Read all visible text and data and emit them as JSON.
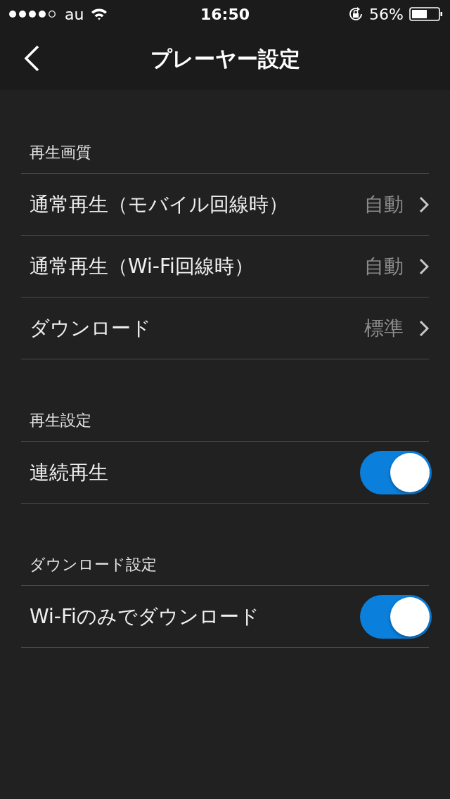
{
  "status_bar": {
    "carrier": "au",
    "time": "16:50",
    "battery_percent": "56%"
  },
  "nav_bar": {
    "title": "プレーヤー設定"
  },
  "sections": [
    {
      "header": "再生画質",
      "rows": [
        {
          "kind": "link",
          "label": "通常再生（モバイル回線時）",
          "value": "自動"
        },
        {
          "kind": "link",
          "label": "通常再生（Wi-Fi回線時）",
          "value": "自動"
        },
        {
          "kind": "link",
          "label": "ダウンロード",
          "value": "標準"
        }
      ]
    },
    {
      "header": "再生設定",
      "rows": [
        {
          "kind": "toggle",
          "label": "連続再生",
          "on": true
        }
      ]
    },
    {
      "header": "ダウンロード設定",
      "rows": [
        {
          "kind": "toggle",
          "label": "Wi-Fiのみでダウンロード",
          "on": true
        }
      ]
    }
  ]
}
